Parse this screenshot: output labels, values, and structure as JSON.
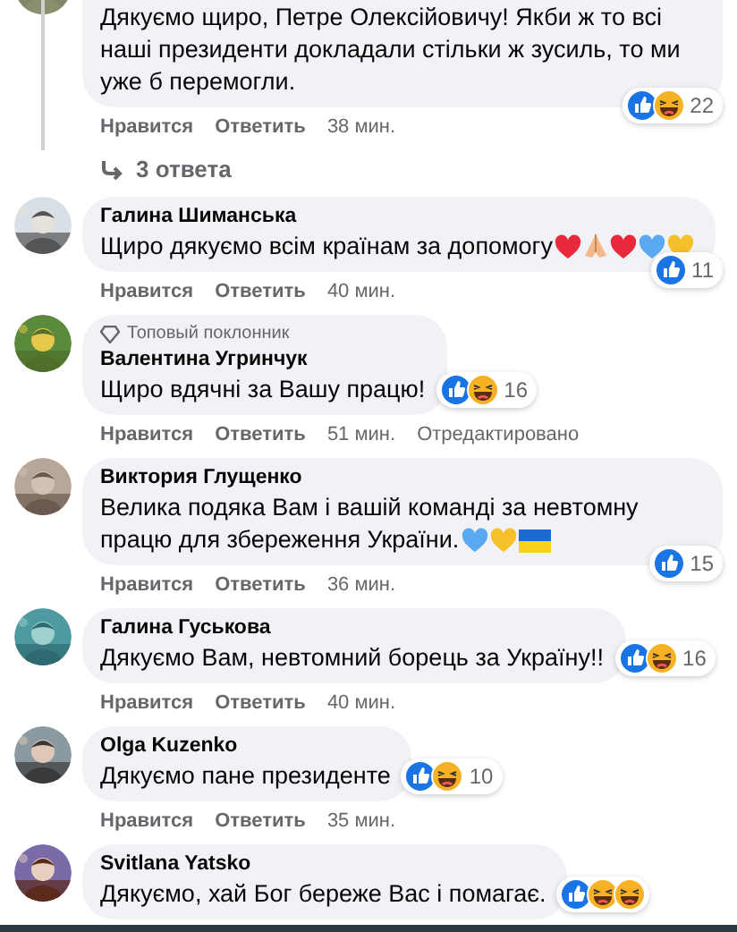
{
  "comments": [
    {
      "text": "Дякуємо щиро, Петре Олексійовичу! Якби ж то всі наші президенти докладали стільки ж зусиль, то ми уже б перемогли.",
      "reactions": {
        "types": [
          {
            "kind": "like"
          },
          {
            "kind": "haha"
          }
        ],
        "count": "22"
      },
      "actions": {
        "like": "Нравится",
        "reply": "Ответить",
        "time": "38 мин."
      },
      "replies": "3 ответа"
    },
    {
      "name": "Галина Шиманська",
      "text": "Щиро дякуємо всім країнам за допомогу",
      "emojis": [
        {
          "kind": "heart",
          "color": "#e8293b"
        },
        {
          "kind": "pray"
        },
        {
          "kind": "heart",
          "color": "#e8293b"
        },
        {
          "kind": "heart",
          "color": "#5aa9f0"
        },
        {
          "kind": "heart",
          "color": "#f5c02a"
        }
      ],
      "reactions": {
        "types": [
          {
            "kind": "like"
          }
        ],
        "count": "11"
      },
      "actions": {
        "like": "Нравится",
        "reply": "Ответить",
        "time": "40 мин."
      }
    },
    {
      "badge": "Топовый поклонник",
      "name": "Валентина Угринчук",
      "text": "Щиро вдячні за Вашу працю!",
      "reactions": {
        "types": [
          {
            "kind": "like"
          },
          {
            "kind": "haha"
          }
        ],
        "count": "16"
      },
      "actions": {
        "like": "Нравится",
        "reply": "Ответить",
        "time": "51 мин.",
        "edited": "Отредактировано"
      }
    },
    {
      "name": "Виктория Глущенко",
      "text": "Велика подяка Вам і вашій команді за невтомну працю для збереження України.",
      "emojis": [
        {
          "kind": "heart",
          "color": "#5aa9f0"
        },
        {
          "kind": "heart",
          "color": "#f5c02a"
        },
        {
          "kind": "flag"
        }
      ],
      "reactions": {
        "types": [
          {
            "kind": "like"
          }
        ],
        "count": "15"
      },
      "actions": {
        "like": "Нравится",
        "reply": "Ответить",
        "time": "36 мин."
      }
    },
    {
      "name": "Галина Гуськова",
      "text": "Дякуємо Вам, невтомний борець за Україну!!",
      "reactions": {
        "types": [
          {
            "kind": "like"
          },
          {
            "kind": "haha"
          }
        ],
        "count": "16"
      },
      "actions": {
        "like": "Нравится",
        "reply": "Ответить",
        "time": "40 мин."
      }
    },
    {
      "name": "Olga Kuzenko",
      "text": "Дякуємо пане президенте",
      "reactions": {
        "types": [
          {
            "kind": "like"
          },
          {
            "kind": "haha"
          }
        ],
        "count": "10"
      },
      "actions": {
        "like": "Нравится",
        "reply": "Ответить",
        "time": "35 мин."
      }
    },
    {
      "name": "Svitlana Yatsko",
      "text": "Дякуємо, хай Бог береже Вас і помагає.",
      "reactions": {
        "types": [
          {
            "kind": "like"
          },
          {
            "kind": "haha"
          },
          {
            "kind": "haha"
          }
        ]
      }
    }
  ]
}
